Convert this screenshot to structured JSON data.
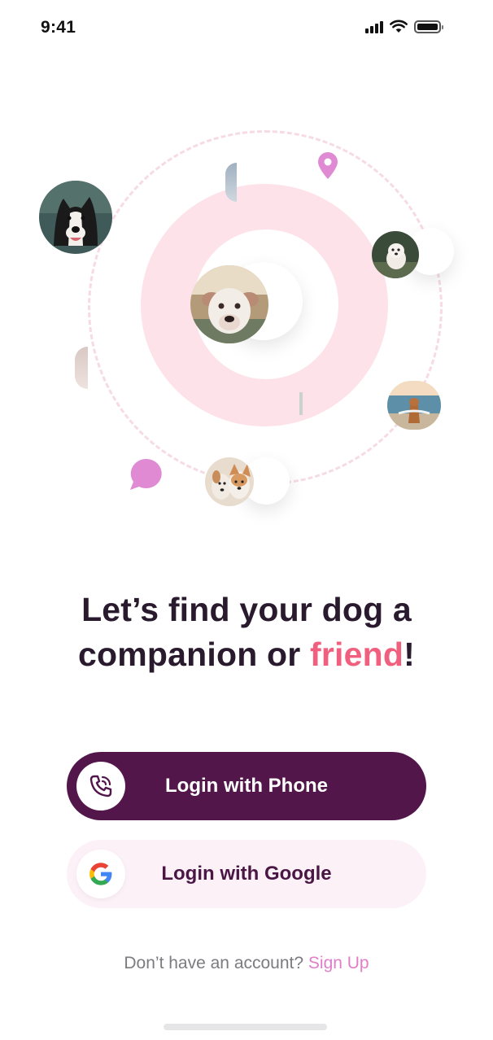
{
  "status_bar": {
    "time": "9:41"
  },
  "illustration": {
    "avatars": [
      "border-collie-photo",
      "pitbull-photo",
      "white-puppy-photo",
      "golden-dog-beach-photo",
      "two-dogs-photo"
    ],
    "icons": [
      "location-pin-icon",
      "chat-bubble-icon"
    ],
    "colors": {
      "ring": "#fde3e9",
      "orbit": "#f6dbe6",
      "icon": "#e08ad4"
    }
  },
  "headline": {
    "line1": "Let’s find your dog a",
    "line2_prefix": "companion or ",
    "accent_word": "friend",
    "line2_suffix": "!"
  },
  "buttons": {
    "phone_label": "Login with Phone",
    "google_label": "Login with Google"
  },
  "signup": {
    "prompt": "Don’t have an account? ",
    "link": "Sign Up"
  },
  "colors": {
    "primary": "#53164b",
    "accent": "#f0607e",
    "link": "#e07ec8",
    "google_bg": "#fdf1f8"
  }
}
